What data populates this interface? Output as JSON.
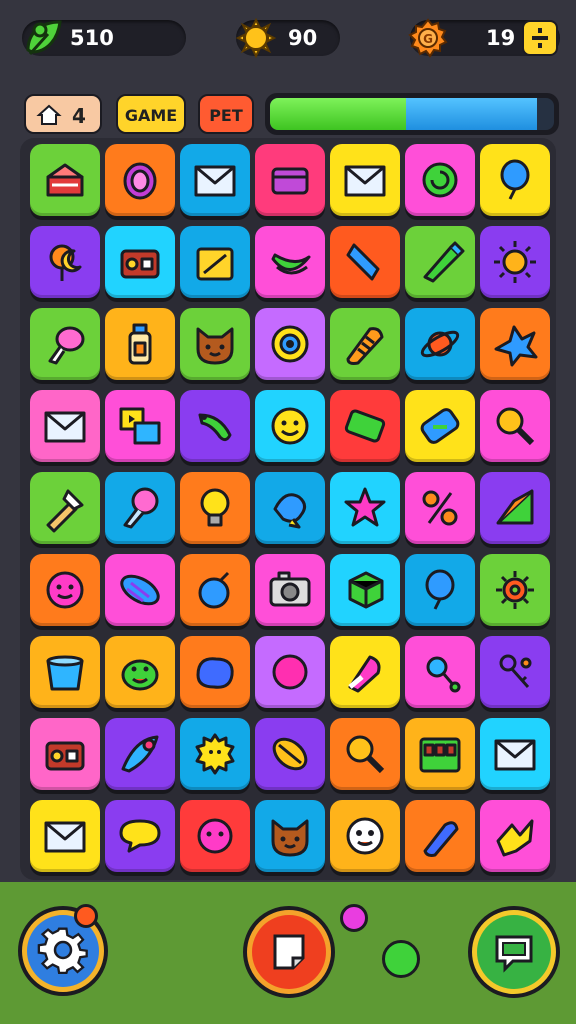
{
  "resources": {
    "leaves": {
      "value": "510",
      "icon": "green-leaf-icon"
    },
    "coins": {
      "value": "90",
      "icon": "sun-coin-icon"
    },
    "gems": {
      "value": "19",
      "icon": "orange-gear-coin-icon",
      "action_icon": "plus-minus-icon"
    }
  },
  "chips": {
    "home": {
      "label": "4",
      "icon": "house-icon"
    },
    "game": {
      "label": "GAME"
    },
    "pet": {
      "label": "PET"
    }
  },
  "progress": {
    "green_fraction": 0.48,
    "blue_fraction": 0.46
  },
  "colors": {
    "background": "#35353f",
    "bottom_bar": "#5e9a34",
    "tile_palette": [
      "#6cd13a",
      "#ff7b1c",
      "#12a9e8",
      "#ff3b7c",
      "#ffe21a",
      "#ff4fd8",
      "#8a3df0",
      "#21d3ff",
      "#ff5a1f"
    ]
  },
  "grid": {
    "rows": 9,
    "cols": 7,
    "tiles": [
      [
        "#6cd13a",
        "cake-icon"
      ],
      [
        "#ff7b1c",
        "egg-icon"
      ],
      [
        "#12a9e8",
        "envelope-icon"
      ],
      [
        "#ff3b7c",
        "box-icon"
      ],
      [
        "#ffe21a",
        "envelope-icon"
      ],
      [
        "#ff4fd8",
        "swirl-candy-icon"
      ],
      [
        "#ffe21a",
        "balloon-icon"
      ],
      [
        "#8a3df0",
        "moon-lollipop-icon"
      ],
      [
        "#21d3ff",
        "radio-icon"
      ],
      [
        "#12a9e8",
        "gift-icon"
      ],
      [
        "#ff4fd8",
        "banana-icon"
      ],
      [
        "#ff5a1f",
        "bone-icon"
      ],
      [
        "#6cd13a",
        "marker-icon"
      ],
      [
        "#8a3df0",
        "sun-icon"
      ],
      [
        "#6cd13a",
        "drumstick-icon"
      ],
      [
        "#ffb31a",
        "bottle-icon"
      ],
      [
        "#6cd13a",
        "cat-face-icon"
      ],
      [
        "#c56bff",
        "eye-icon"
      ],
      [
        "#6cd13a",
        "bread-icon"
      ],
      [
        "#12a9e8",
        "saturn-icon"
      ],
      [
        "#ff7b1c",
        "splat-icon"
      ],
      [
        "#ff66c8",
        "envelope-icon"
      ],
      [
        "#ff4fd8",
        "photo-icon"
      ],
      [
        "#8a3df0",
        "caterpillar-icon"
      ],
      [
        "#21d3ff",
        "smiley-icon"
      ],
      [
        "#ff3b3b",
        "bar-icon"
      ],
      [
        "#ffe21a",
        "battery-icon"
      ],
      [
        "#ff4fd8",
        "magnifier-icon"
      ],
      [
        "#6cd13a",
        "knife-icon"
      ],
      [
        "#12a9e8",
        "ice-cream-icon"
      ],
      [
        "#ff7b1c",
        "lightbulb-icon"
      ],
      [
        "#12a9e8",
        "fish-icon"
      ],
      [
        "#21d3ff",
        "star-icon"
      ],
      [
        "#ff4fd8",
        "scissors-icon"
      ],
      [
        "#8a3df0",
        "flag-icon"
      ],
      [
        "#ff7b1c",
        "blob-face-icon"
      ],
      [
        "#ff4fd8",
        "candy-icon"
      ],
      [
        "#ff7b1c",
        "bomb-icon"
      ],
      [
        "#ff4fd8",
        "camera-icon"
      ],
      [
        "#21d3ff",
        "cube-icon"
      ],
      [
        "#12a9e8",
        "balloon-icon"
      ],
      [
        "#6cd13a",
        "gear-icon"
      ],
      [
        "#ffb31a",
        "bucket-icon"
      ],
      [
        "#ffb31a",
        "frog-icon"
      ],
      [
        "#ff7b1c",
        "jelly-icon"
      ],
      [
        "#c56bff",
        "ball-icon"
      ],
      [
        "#ffe21a",
        "popsicle-icon"
      ],
      [
        "#ff4fd8",
        "rattle-icon"
      ],
      [
        "#8a3df0",
        "key-icon"
      ],
      [
        "#ff66c8",
        "radio-icon"
      ],
      [
        "#8a3df0",
        "fern-icon"
      ],
      [
        "#12a9e8",
        "sun-face-icon"
      ],
      [
        "#8a3df0",
        "leaf-icon"
      ],
      [
        "#ff7b1c",
        "magnifier-icon"
      ],
      [
        "#ffb31a",
        "calendar-icon"
      ],
      [
        "#21d3ff",
        "envelope-icon"
      ],
      [
        "#ffe21a",
        "envelope-icon"
      ],
      [
        "#8a3df0",
        "chat-bubble-icon"
      ],
      [
        "#ff3b3b",
        "fuzzy-face-icon"
      ],
      [
        "#12a9e8",
        "cat-face-icon"
      ],
      [
        "#ffb31a",
        "ghost-face-icon"
      ],
      [
        "#ff7b1c",
        "pill-icon"
      ],
      [
        "#ff4fd8",
        "bird-icon"
      ]
    ]
  },
  "bottom": {
    "settings_icon": "gear-icon",
    "note_icon": "note-icon",
    "chat_icon": "chat-screen-icon"
  }
}
